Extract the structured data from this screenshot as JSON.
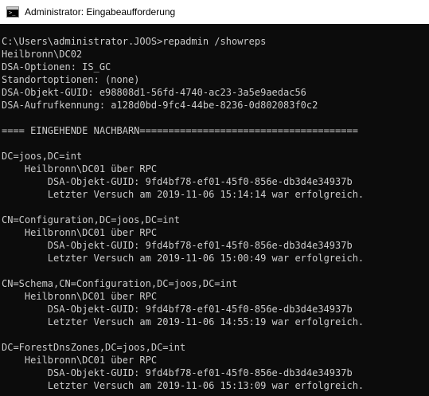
{
  "window": {
    "title": "Administrator: Eingabeaufforderung",
    "icon": "command-prompt-icon"
  },
  "colors": {
    "console_background": "#0c0c0c",
    "console_text": "#cccccc",
    "titlebar_background": "#ffffff"
  },
  "console": {
    "lines": [
      "C:\\Users\\administrator.JOOS>repadmin /showreps",
      "Heilbronn\\DC02",
      "DSA-Optionen: IS_GC",
      "Standortoptionen: (none)",
      "DSA-Objekt-GUID: e98808d1-56fd-4740-ac23-3a5e9aedac56",
      "DSA-Aufrufkennung: a128d0bd-9fc4-44be-8236-0d802083f0c2",
      "",
      "==== EINGEHENDE NACHBARN======================================",
      "",
      "DC=joos,DC=int",
      "    Heilbronn\\DC01 über RPC",
      "        DSA-Objekt-GUID: 9fd4bf78-ef01-45f0-856e-db3d4e34937b",
      "        Letzter Versuch am 2019-11-06 15:14:14 war erfolgreich.",
      "",
      "CN=Configuration,DC=joos,DC=int",
      "    Heilbronn\\DC01 über RPC",
      "        DSA-Objekt-GUID: 9fd4bf78-ef01-45f0-856e-db3d4e34937b",
      "        Letzter Versuch am 2019-11-06 15:00:49 war erfolgreich.",
      "",
      "CN=Schema,CN=Configuration,DC=joos,DC=int",
      "    Heilbronn\\DC01 über RPC",
      "        DSA-Objekt-GUID: 9fd4bf78-ef01-45f0-856e-db3d4e34937b",
      "        Letzter Versuch am 2019-11-06 14:55:19 war erfolgreich.",
      "",
      "DC=ForestDnsZones,DC=joos,DC=int",
      "    Heilbronn\\DC01 über RPC",
      "        DSA-Objekt-GUID: 9fd4bf78-ef01-45f0-856e-db3d4e34937b",
      "        Letzter Versuch am 2019-11-06 15:13:09 war erfolgreich."
    ]
  }
}
